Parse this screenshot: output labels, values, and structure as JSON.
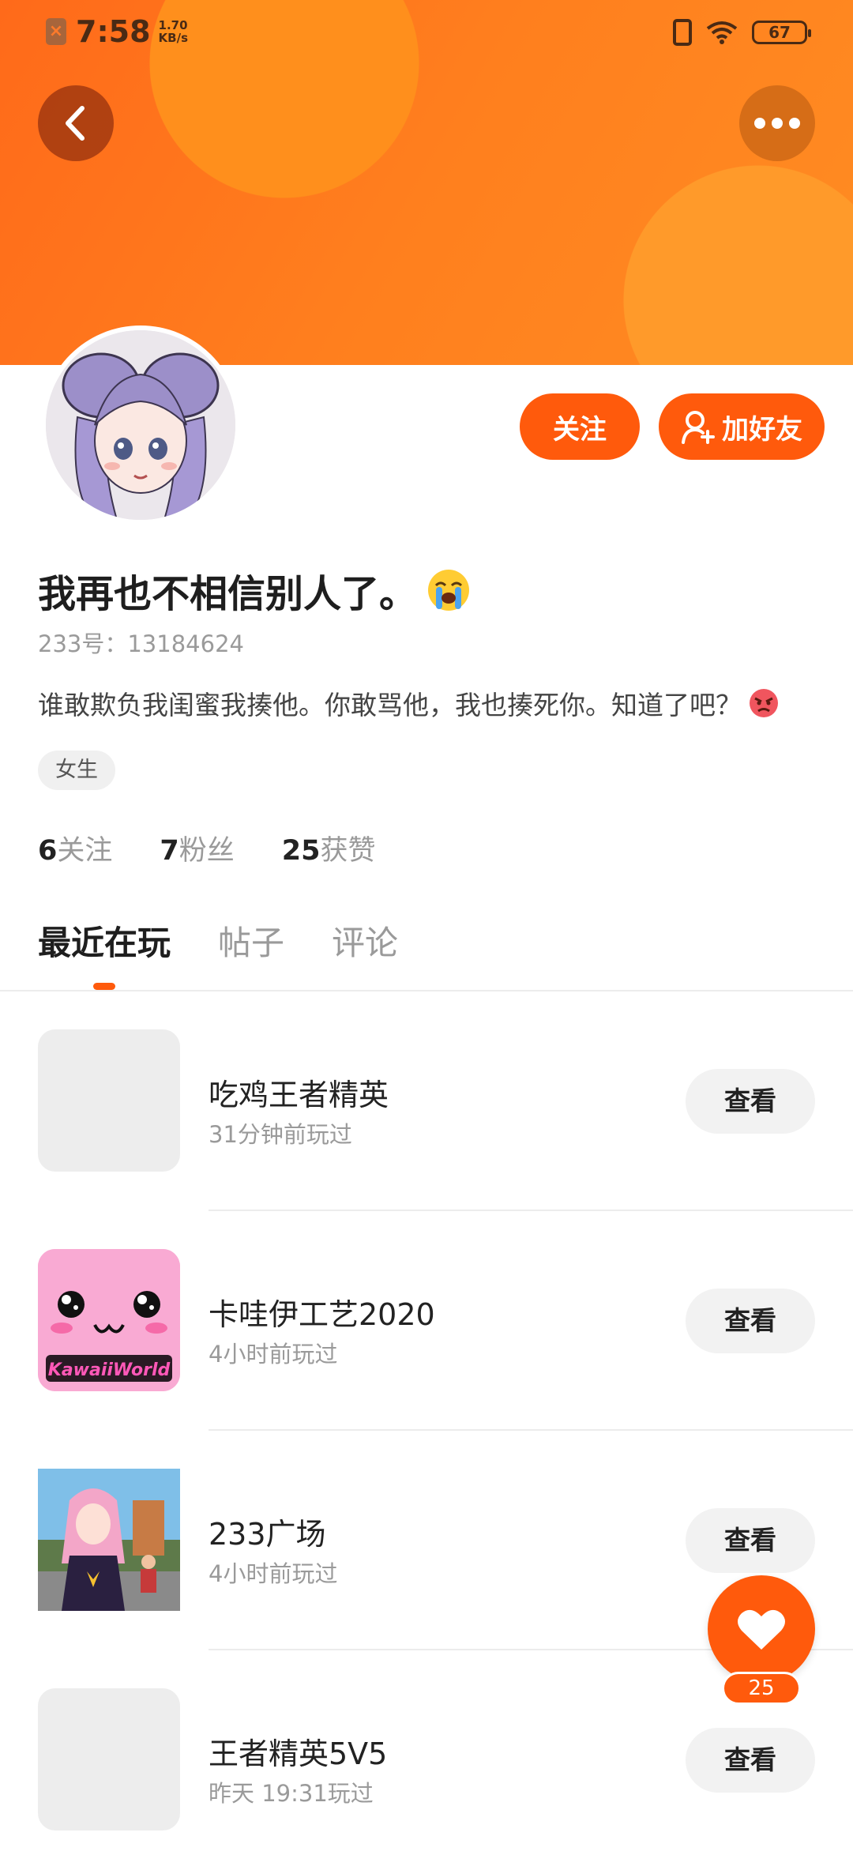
{
  "status_bar": {
    "time": "7:58",
    "speed_value": "1.70",
    "speed_unit": "KB/s",
    "battery": "67"
  },
  "profile": {
    "name": "我再也不相信别人了。",
    "uid_label": "233号：",
    "uid_value": "13184624",
    "bio": "谁敢欺负我闺蜜我揍他。你敢骂他，我也揍死你。知道了吧？",
    "gender_tag": "女生"
  },
  "actions": {
    "follow_label": "关注",
    "add_friend_label": "加好友"
  },
  "stats": [
    {
      "value": "6",
      "label": "关注"
    },
    {
      "value": "7",
      "label": "粉丝"
    },
    {
      "value": "25",
      "label": "获赞"
    }
  ],
  "tabs": [
    {
      "label": "最近在玩",
      "active": true
    },
    {
      "label": "帖子",
      "active": false
    },
    {
      "label": "评论",
      "active": false
    }
  ],
  "games": [
    {
      "name": "吃鸡王者精英",
      "time": "31分钟前玩过",
      "button": "查看",
      "icon": "placeholder"
    },
    {
      "name": "卡哇伊工艺2020",
      "time": "4小时前玩过",
      "button": "查看",
      "icon": "kawaii-world-icon",
      "icon_text": "KawaiiWorld"
    },
    {
      "name": "233广场",
      "time": "4小时前玩过",
      "button": "查看",
      "icon": "anime-plaza-icon"
    },
    {
      "name": "王者精英5V5",
      "time": "昨天 19:31玩过",
      "button": "查看",
      "icon": "placeholder"
    }
  ],
  "like_fab": {
    "count": "25"
  },
  "colors": {
    "accent": "#ff5a0c",
    "banner": "#ff7a1e"
  }
}
